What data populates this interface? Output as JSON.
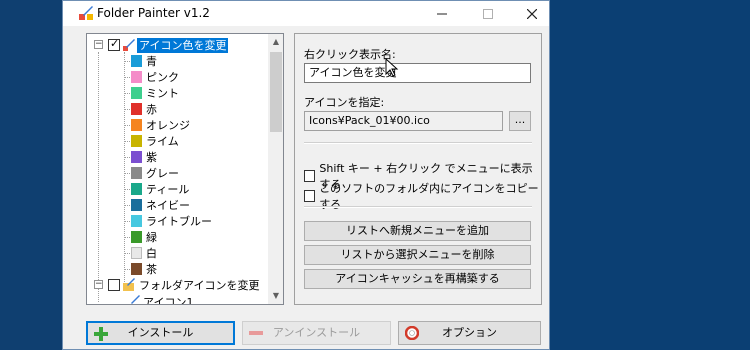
{
  "window": {
    "title": "Folder Painter v1.2",
    "minimize_icon": "minimize-icon",
    "maximize_icon": "maximize-icon",
    "close_icon": "close-icon"
  },
  "tree": {
    "root": {
      "label": "アイコン色を変更",
      "checked": true,
      "expanded": true
    },
    "items": [
      {
        "label": "青",
        "color": "#1a9cd8"
      },
      {
        "label": "ピンク",
        "color": "#f48cc8"
      },
      {
        "label": "ミント",
        "color": "#3ecf8e"
      },
      {
        "label": "赤",
        "color": "#e0302a"
      },
      {
        "label": "オレンジ",
        "color": "#f5841f"
      },
      {
        "label": "ライム",
        "color": "#c8b400"
      },
      {
        "label": "紫",
        "color": "#7b4fd0"
      },
      {
        "label": "グレー",
        "color": "#8a8a8a"
      },
      {
        "label": "ティール",
        "color": "#19a88a"
      },
      {
        "label": "ネイビー",
        "color": "#1a6e9c"
      },
      {
        "label": "ライトブルー",
        "color": "#46c8e0"
      },
      {
        "label": "緑",
        "color": "#3a9a2a"
      },
      {
        "label": "白",
        "color": "#e8e8e8"
      },
      {
        "label": "茶",
        "color": "#7a4a2a"
      }
    ],
    "second_root": {
      "label": "フォルダアイコンを変更",
      "checked": false,
      "expanded": true
    },
    "partial_child": {
      "label": "アイコン1"
    }
  },
  "panel": {
    "name_label": "右クリック表示名:",
    "name_value": "アイコン色を変更",
    "icon_label": "アイコンを指定:",
    "icon_value": "Icons¥Pack_01¥00.ico",
    "browse_label": "...",
    "opt_shift_label": "Shift キー + 右クリック でメニューに表示する",
    "opt_copy_label": "このソフトのフォルダ内にアイコンをコピーする",
    "add_label": "リストへ新規メニューを追加",
    "remove_label": "リストから選択メニューを削除",
    "rebuild_label": "アイコンキャッシュを再構築する"
  },
  "footer": {
    "install_label": "インストール",
    "uninstall_label": "アンインストール",
    "options_label": "オプション"
  },
  "colors": {
    "selection": "#0078d7",
    "desktop": "#0b3f73"
  }
}
